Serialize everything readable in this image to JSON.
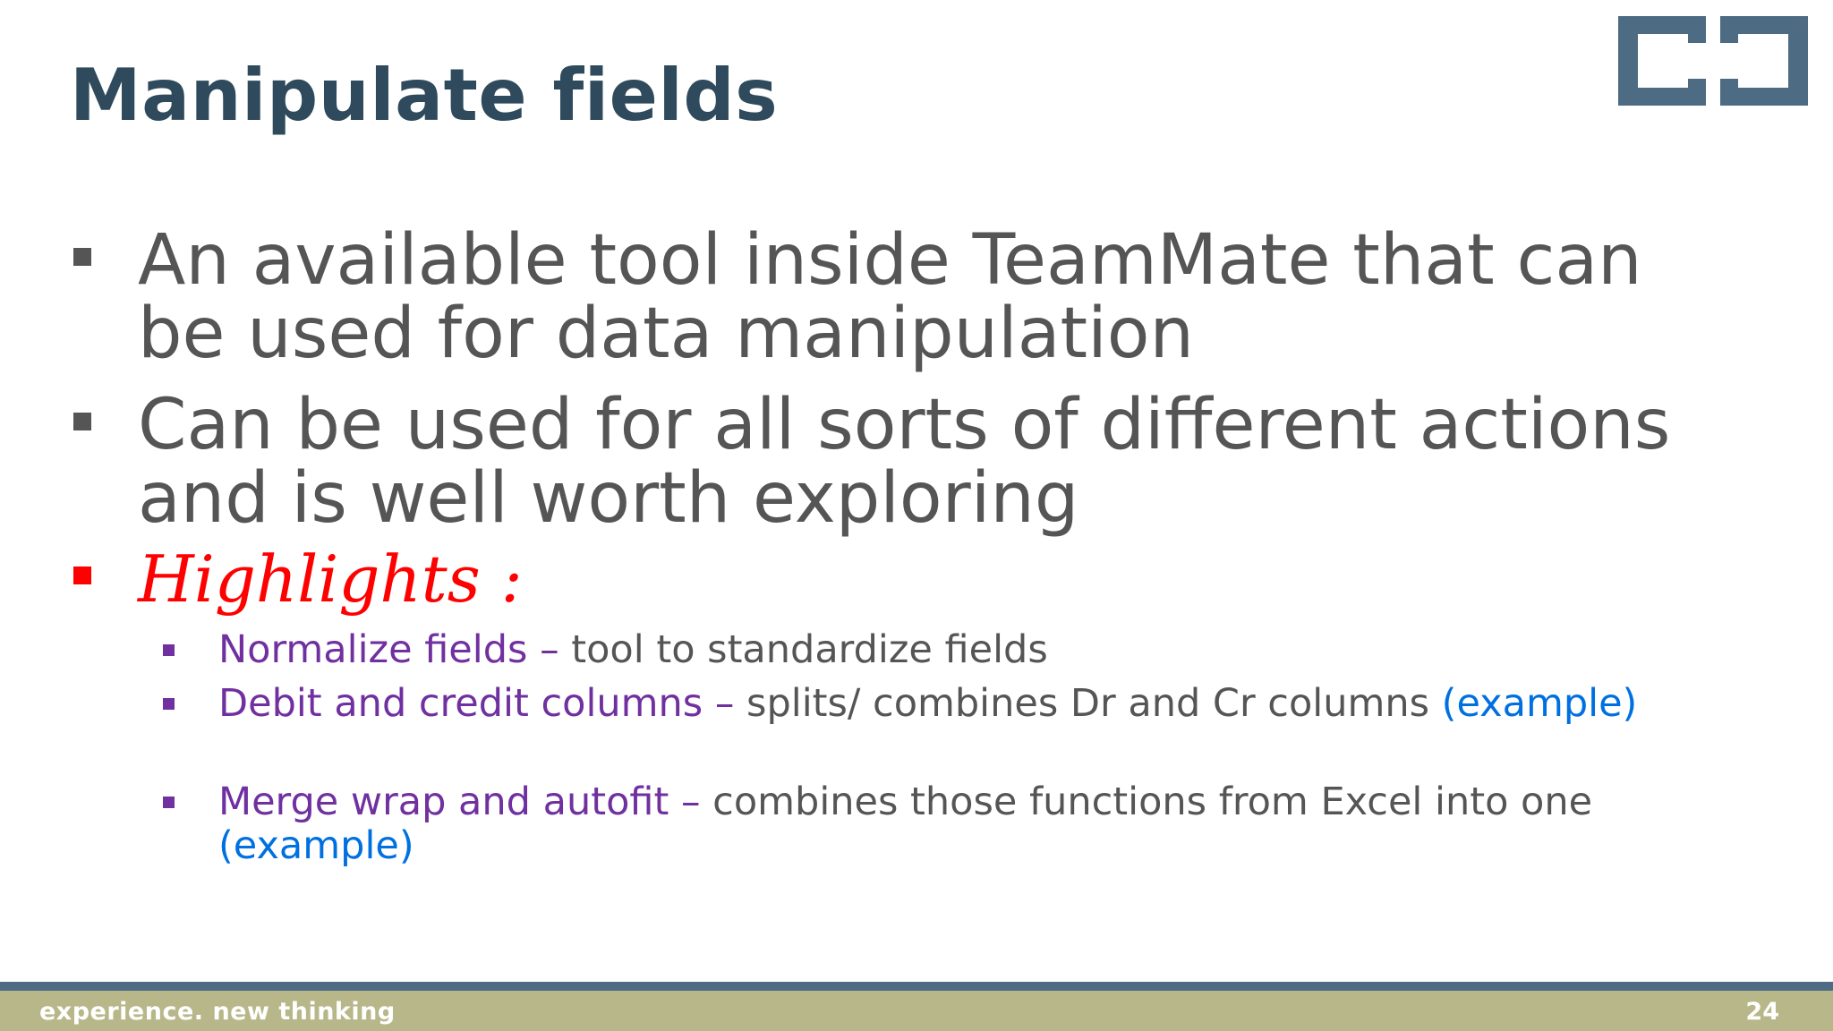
{
  "slide": {
    "title": "Manipulate fields",
    "bullets": [
      {
        "text": "An available tool inside TeamMate that can be used for data manipulation"
      },
      {
        "text": "Can be used for all sorts of different actions and is well worth exploring"
      }
    ],
    "highlights_heading": "Highlights :",
    "sub_bullets": [
      {
        "term": "Normalize fields –",
        "desc": " tool to standardize fields",
        "link": ""
      },
      {
        "term": "Debit and credit columns –",
        "desc": " splits/ combines Dr and Cr columns ",
        "link": "(example)"
      },
      {
        "term": "Merge wrap and autofit –",
        "desc": " combines those functions from Excel into one ",
        "link": "(example)"
      }
    ]
  },
  "footer": {
    "tagline": "experience. new thinking",
    "page_number": "24"
  },
  "colors": {
    "title": "#2e4a5c",
    "body_text": "#555555",
    "highlight": "#ff0000",
    "term": "#7030a0",
    "link": "#0070e0",
    "footer_band": "#b7b78a",
    "footer_rule": "#4d6b82"
  },
  "icons": {
    "logo": "bracket-logo-icon"
  }
}
